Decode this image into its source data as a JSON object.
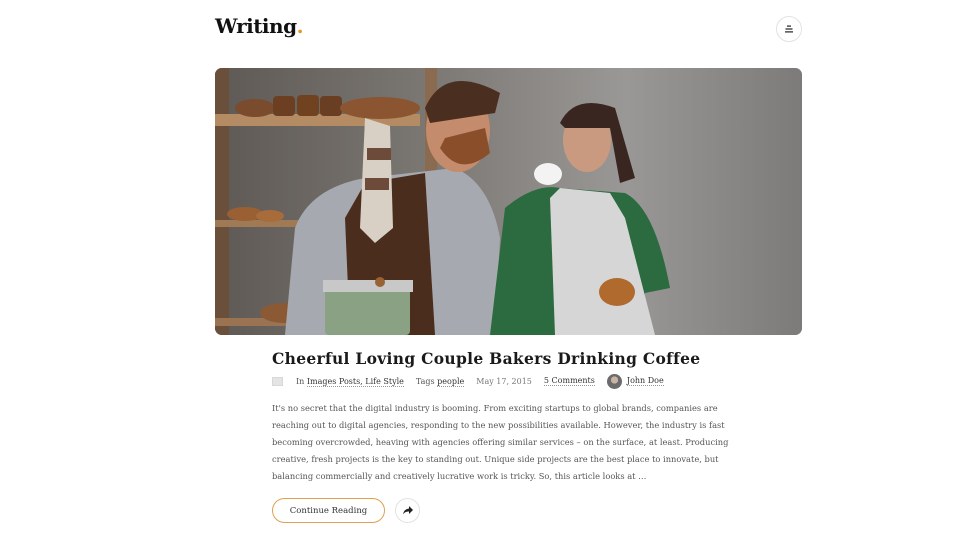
{
  "header": {
    "logo_text": "Writing",
    "logo_dot": ".",
    "menu_icon": "menu-lines-icon"
  },
  "post": {
    "image_alt": "Cheerful loving couple of bakers drinking coffee in a bakery",
    "title": "Cheerful Loving Couple Bakers Drinking Coffee",
    "meta": {
      "format_icon": "image-format-icon",
      "in_label": "In",
      "categories": "Images Posts, Life Style",
      "tags_label": "Tags",
      "tags": "people",
      "date": "May 17, 2015",
      "comments": "5 Comments",
      "author": "John Doe"
    },
    "excerpt": "It's no secret that the digital industry is booming. From exciting startups to global brands, companies are reaching out to digital agencies, responding to the new possibilities available. However, the industry is fast becoming overcrowded, heaving with agencies offering similar services – on the surface, at least. Producing creative, fresh projects is the key to standing out. Unique side projects are the best place to innovate, but balancing commercially and creatively lucrative work is tricky. So, this article looks at …",
    "continue_label": "Continue Reading",
    "share_icon": "share-arrow-icon"
  },
  "colors": {
    "accent": "#e8952b",
    "button_border": "#e0a050",
    "text": "#222222",
    "muted": "#555555"
  }
}
